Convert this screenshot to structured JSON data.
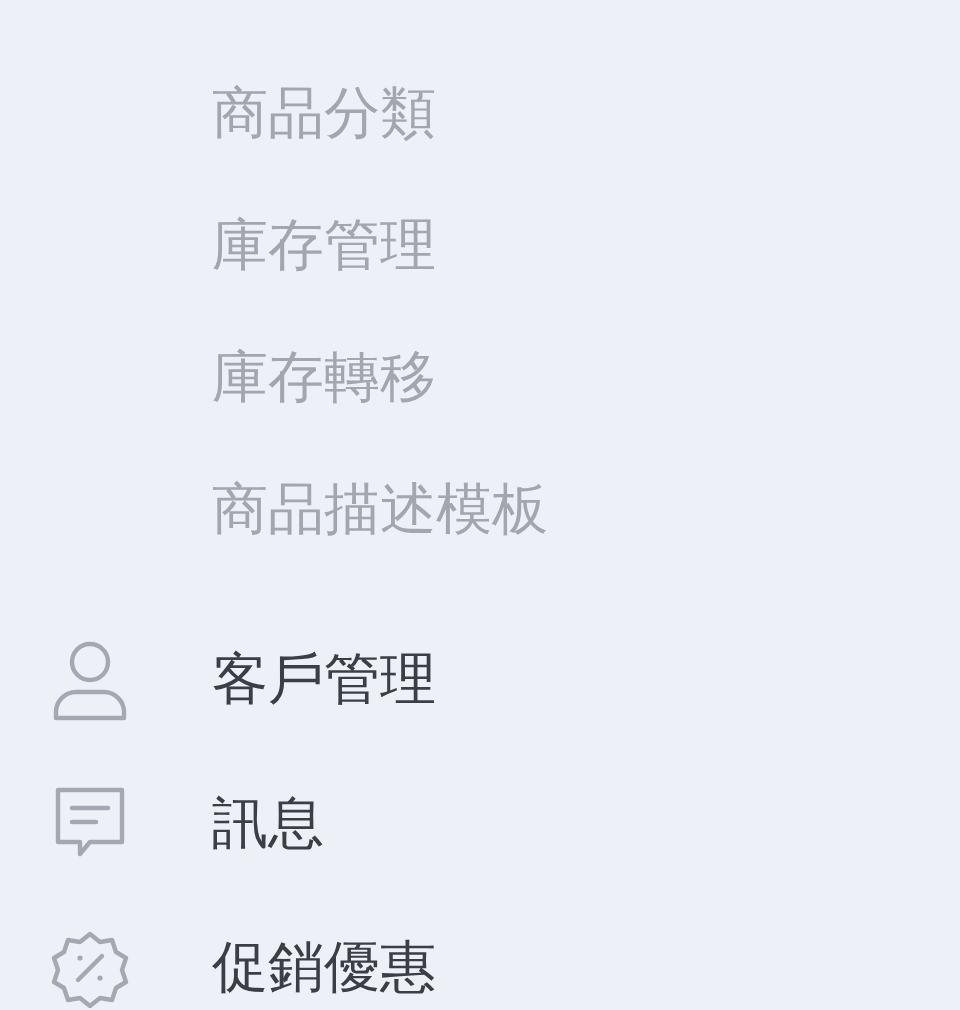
{
  "submenu": [
    {
      "label": "商品分類"
    },
    {
      "label": "庫存管理"
    },
    {
      "label": "庫存轉移"
    },
    {
      "label": "商品描述模板"
    }
  ],
  "menu": [
    {
      "label": "客戶管理",
      "kind": "person"
    },
    {
      "label": "訊息",
      "kind": "message"
    },
    {
      "label": "促銷優惠",
      "kind": "discount"
    }
  ]
}
